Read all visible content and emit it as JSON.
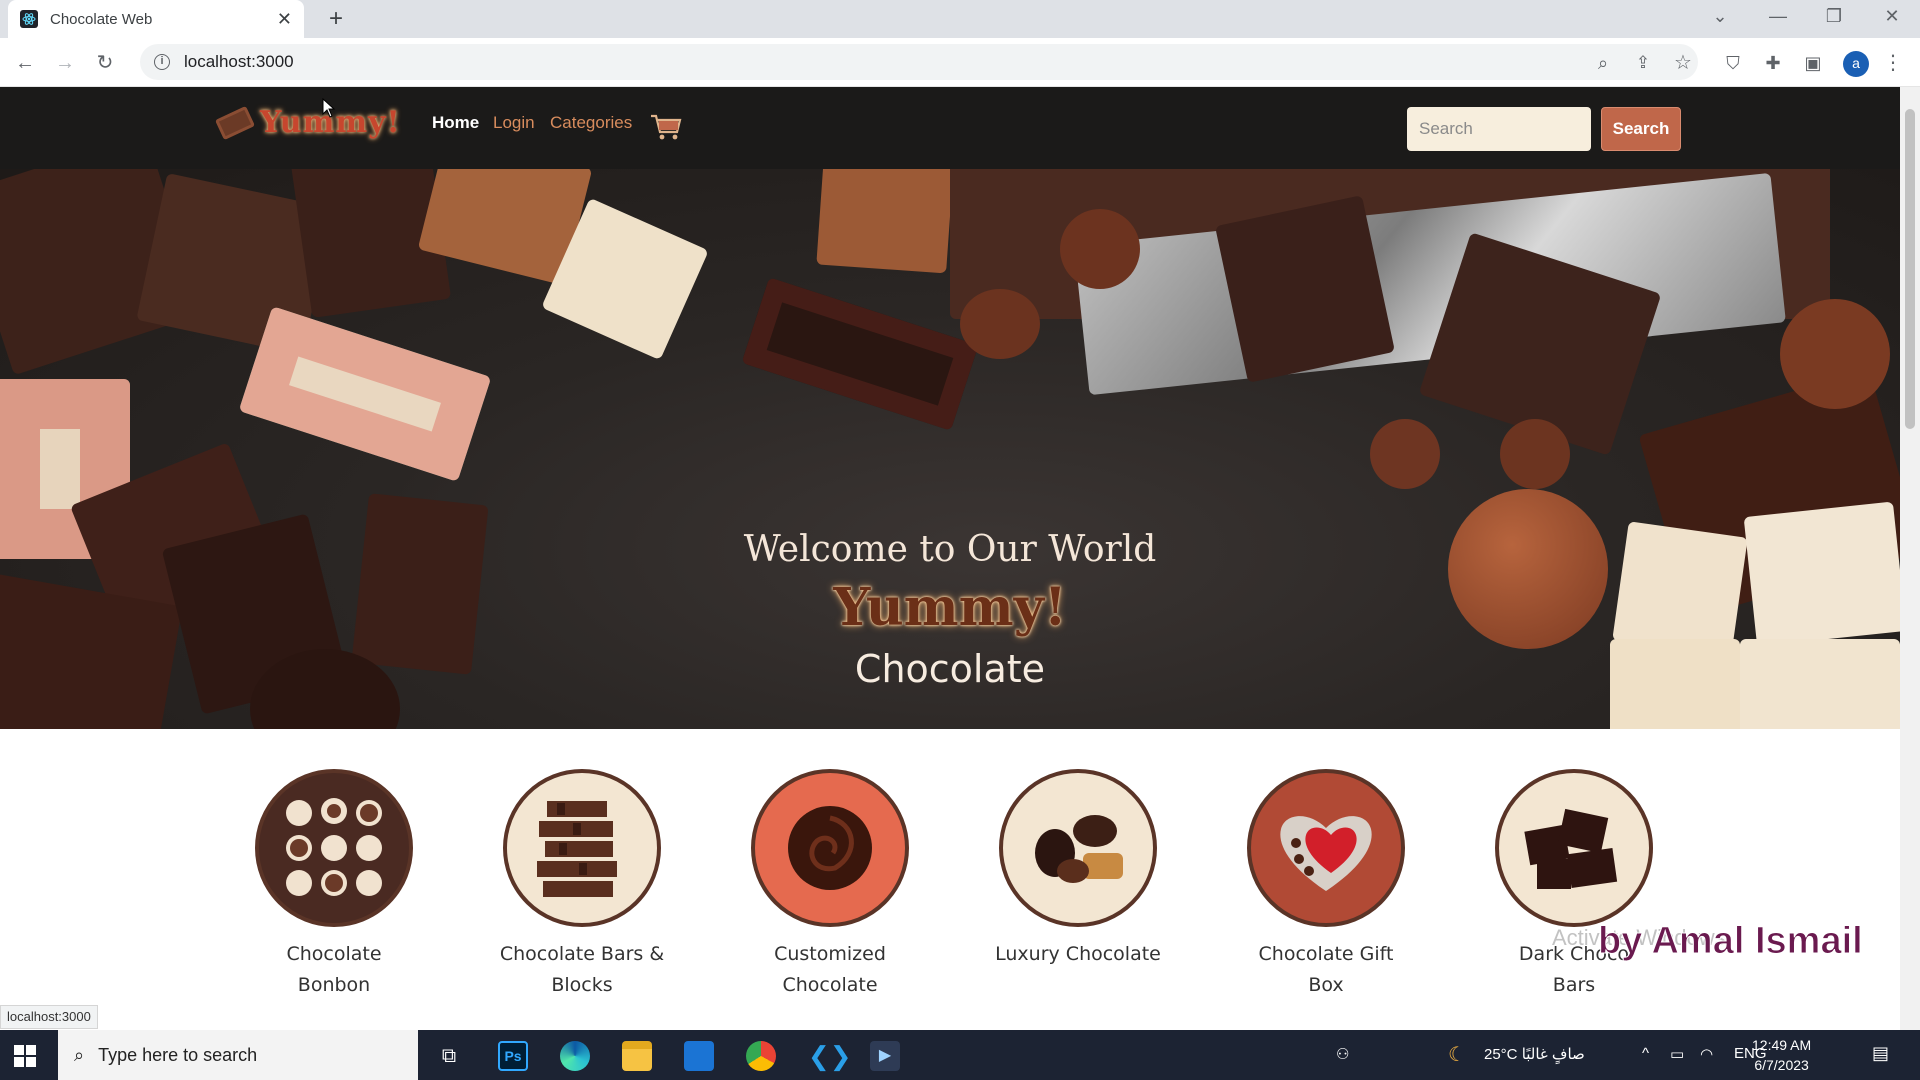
{
  "browser": {
    "tab_title": "Chocolate Web",
    "new_tab": "+",
    "url": "localhost:3000",
    "avatar_letter": "a",
    "status_url": "localhost:3000"
  },
  "nav": {
    "logo_text": "Yummy!",
    "links": [
      "Home",
      "Login",
      "Categories"
    ],
    "search_placeholder": "Search",
    "search_button": "Search"
  },
  "hero": {
    "welcome": "Welcome to Our World",
    "brand": "Yummy!",
    "subtitle": "Chocolate"
  },
  "categories": [
    {
      "label_line1": "Chocolate",
      "label_line2": "Bonbon",
      "accent": "#4a2a22"
    },
    {
      "label_line1": "Chocolate Bars &",
      "label_line2": "Blocks",
      "accent": "#f3e6d2"
    },
    {
      "label_line1": "Customized",
      "label_line2": "Chocolate",
      "accent": "#e56a4f"
    },
    {
      "label_line1": "Luxury Chocolate",
      "label_line2": "",
      "accent": "#f3e6d2"
    },
    {
      "label_line1": "Chocolate Gift",
      "label_line2": "Box",
      "accent": "#b14a35"
    },
    {
      "label_line1": "Dark Choco",
      "label_line2": "Bars",
      "accent": "#f3e6d2"
    }
  ],
  "overlay": {
    "watermark": "Activate Windows",
    "byline": "by Amal Ismail"
  },
  "taskbar": {
    "search_text": "Type here to search",
    "weather": "25°C  صافٍ غالبًا",
    "lang": "ENG",
    "time": "12:49 AM",
    "date": "6/7/2023"
  },
  "colors": {
    "nav_bg": "#1b1a19",
    "nav_link": "#d88c5d",
    "search_button": "#c0674a",
    "circle_border": "#5a3427"
  }
}
